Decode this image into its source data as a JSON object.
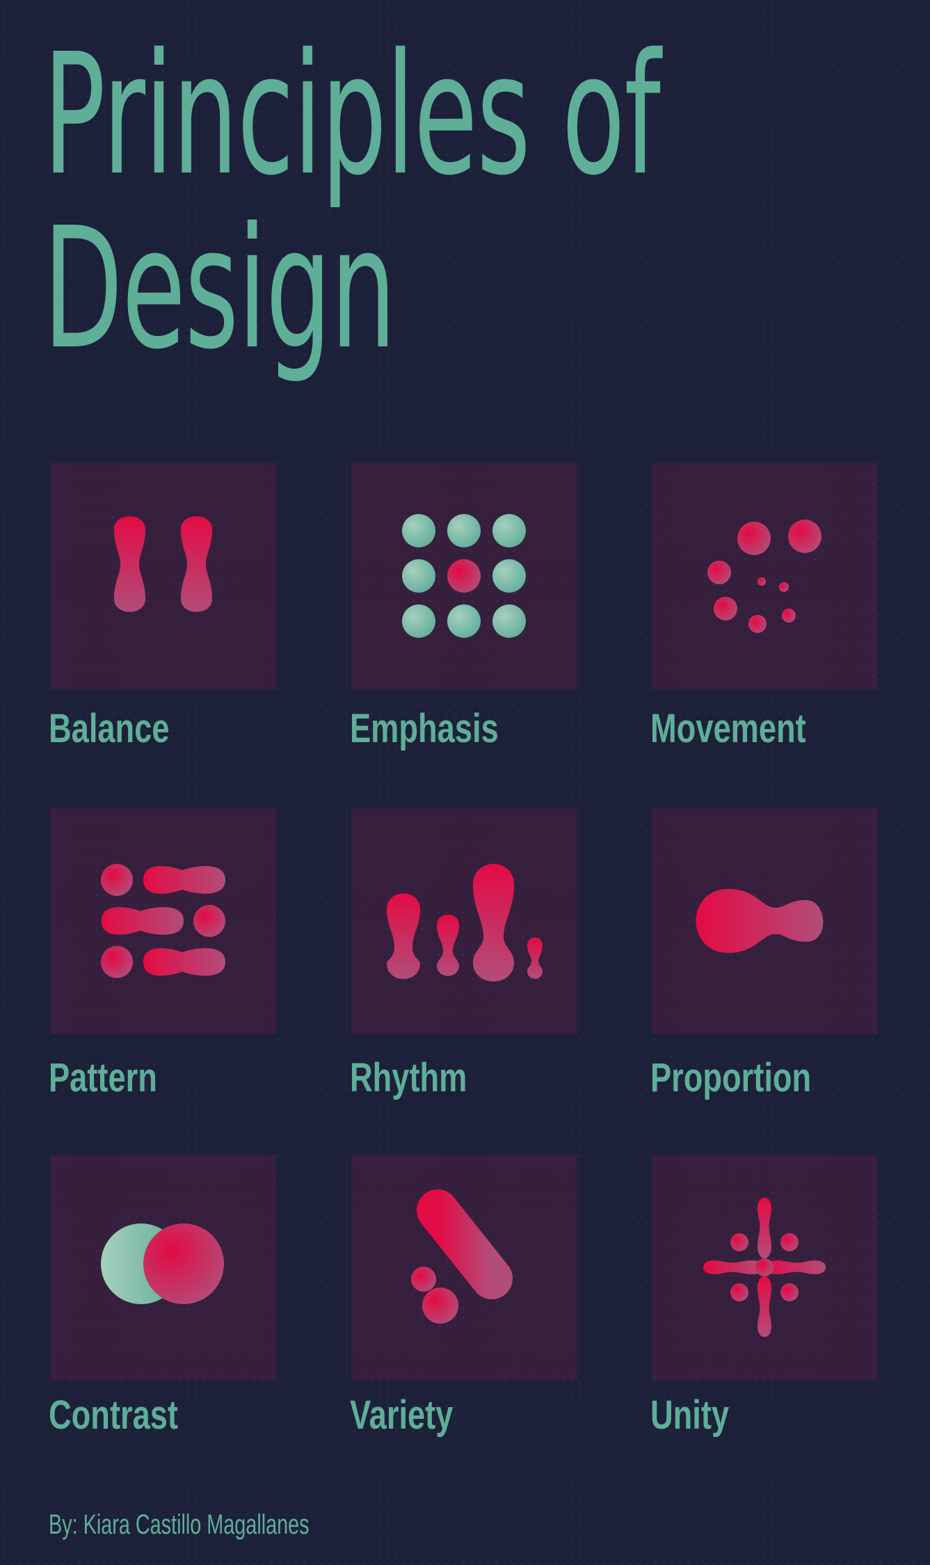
{
  "title": {
    "line1": "Principles of",
    "line2": "Design"
  },
  "colors": {
    "background": "#1c2139",
    "tile": "#351f3d",
    "accent_teal": "#5fae98",
    "accent_red": "#e30b44",
    "accent_mauve": "#b24d79"
  },
  "principles": [
    {
      "label": "Balance",
      "icon": "balance-icon"
    },
    {
      "label": "Emphasis",
      "icon": "emphasis-icon"
    },
    {
      "label": "Movement",
      "icon": "movement-icon"
    },
    {
      "label": "Pattern",
      "icon": "pattern-icon"
    },
    {
      "label": "Rhythm",
      "icon": "rhythm-icon"
    },
    {
      "label": "Proportion",
      "icon": "proportion-icon"
    },
    {
      "label": "Contrast",
      "icon": "contrast-icon"
    },
    {
      "label": "Variety",
      "icon": "variety-icon"
    },
    {
      "label": "Unity",
      "icon": "unity-icon"
    }
  ],
  "credit": "By: Kiara Castillo Magallanes"
}
